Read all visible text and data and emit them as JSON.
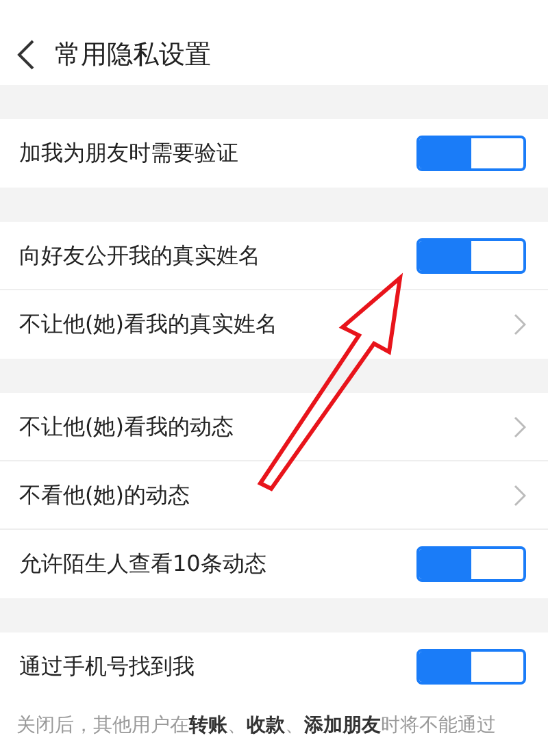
{
  "header": {
    "title": "常用隐私设置"
  },
  "groups": [
    {
      "rows": [
        {
          "label": "加我为朋友时需要验证",
          "kind": "toggle",
          "on": true
        }
      ]
    },
    {
      "rows": [
        {
          "label": "向好友公开我的真实姓名",
          "kind": "toggle",
          "on": true
        },
        {
          "label": "不让他(她)看我的真实姓名",
          "kind": "link"
        }
      ]
    },
    {
      "rows": [
        {
          "label": "不让他(她)看我的动态",
          "kind": "link"
        },
        {
          "label": "不看他(她)的动态",
          "kind": "link"
        },
        {
          "label": "允许陌生人查看10条动态",
          "kind": "toggle",
          "on": true
        }
      ]
    },
    {
      "rows": [
        {
          "label": "通过手机号找到我",
          "kind": "toggle",
          "on": true
        }
      ]
    }
  ],
  "footnote": "关闭后，其他用户在**转账**、**收款**、**添加朋友**时将不能通过"
}
